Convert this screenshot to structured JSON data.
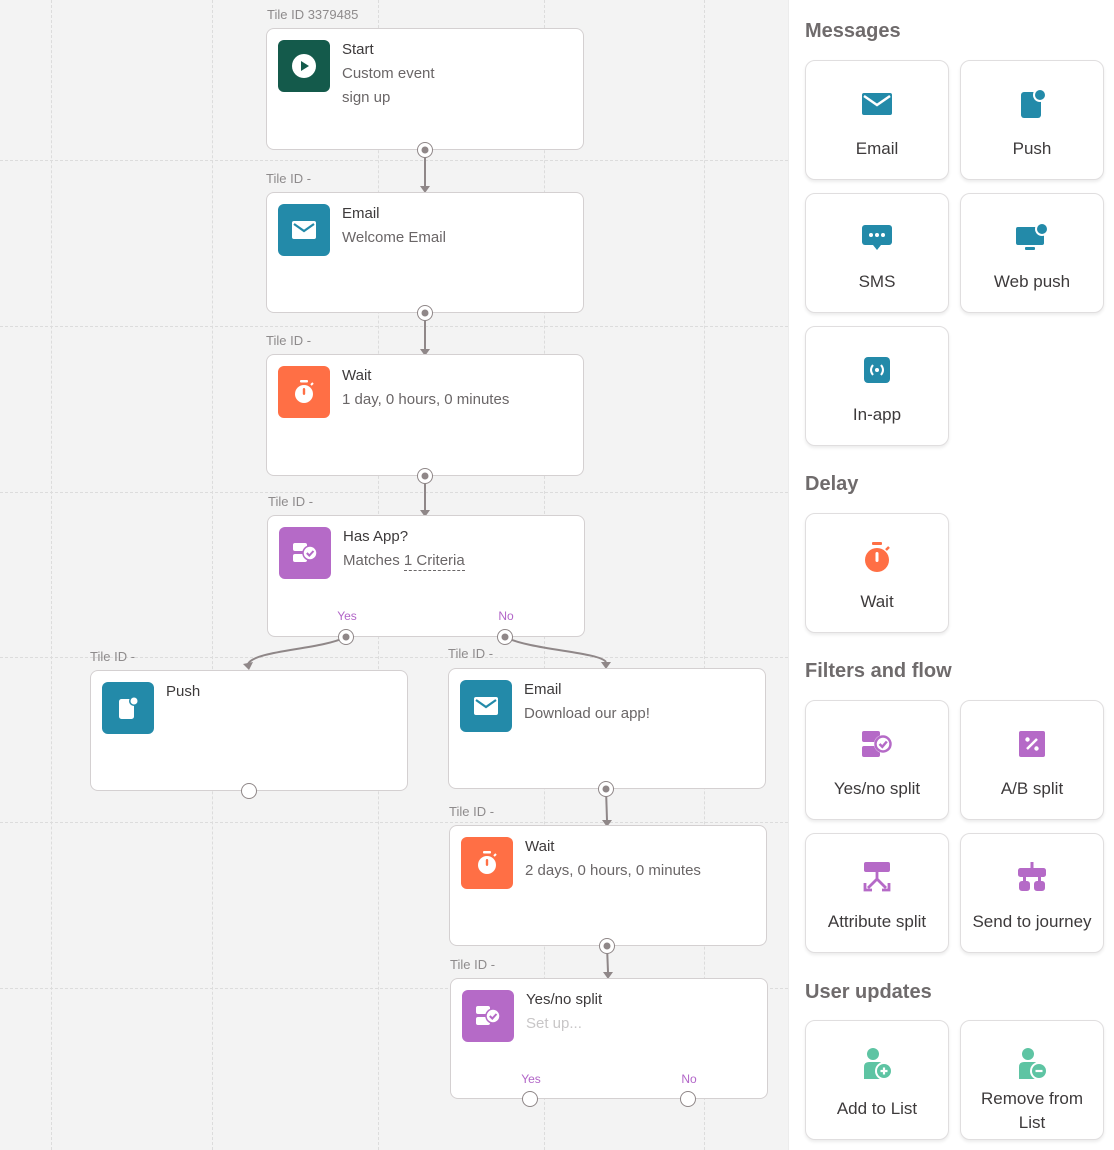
{
  "colors": {
    "teal": "#238aa9",
    "start_green": "#145a4b",
    "orange": "#ff6f45",
    "purple": "#b56ac7",
    "mint": "#5ec4a3",
    "connector": "#8f8788"
  },
  "canvas": {
    "tiles": [
      {
        "id": "start",
        "tile_id_label": "Tile ID 3379485",
        "icon": "play-icon",
        "title": "Start",
        "lines": [
          "Custom event",
          "sign up"
        ]
      },
      {
        "id": "email-welcome",
        "tile_id_label": "Tile ID -",
        "icon": "envelope-icon",
        "title": "Email",
        "lines": [
          "Welcome Email"
        ]
      },
      {
        "id": "wait-1",
        "tile_id_label": "Tile ID -",
        "icon": "stopwatch-icon",
        "title": "Wait",
        "lines": [
          "1 day, 0 hours, 0 minutes"
        ]
      },
      {
        "id": "has-app",
        "tile_id_label": "Tile ID -",
        "icon": "split-check-icon",
        "title": "Has App?",
        "lines_prefix": "Matches ",
        "lines_link": "1 Criteria",
        "yes": "Yes",
        "no": "No"
      },
      {
        "id": "push",
        "tile_id_label": "Tile ID -",
        "icon": "push-notification-icon",
        "title": "Push",
        "lines": []
      },
      {
        "id": "email-download",
        "tile_id_label": "Tile ID -",
        "icon": "envelope-icon",
        "title": "Email",
        "lines": [
          "Download our app!"
        ]
      },
      {
        "id": "wait-2",
        "tile_id_label": "Tile ID -",
        "icon": "stopwatch-icon",
        "title": "Wait",
        "lines": [
          "2 days, 0 hours, 0 minutes"
        ]
      },
      {
        "id": "yes-no-split",
        "tile_id_label": "Tile ID -",
        "icon": "split-check-icon",
        "title": "Yes/no split",
        "placeholder": "Set up...",
        "yes": "Yes",
        "no": "No"
      }
    ]
  },
  "panel": {
    "sections": [
      {
        "title": "Messages",
        "items": [
          {
            "label": "Email",
            "icon": "envelope-icon"
          },
          {
            "label": "Push",
            "icon": "push-notification-icon"
          },
          {
            "label": "SMS",
            "icon": "chat-bubble-icon"
          },
          {
            "label": "Web push",
            "icon": "monitor-notification-icon"
          },
          {
            "label": "In-app",
            "icon": "in-app-icon"
          }
        ]
      },
      {
        "title": "Delay",
        "items": [
          {
            "label": "Wait",
            "icon": "stopwatch-icon"
          }
        ]
      },
      {
        "title": "Filters and flow",
        "items": [
          {
            "label": "Yes/no split",
            "icon": "split-check-icon"
          },
          {
            "label": "A/B split",
            "icon": "percent-icon"
          },
          {
            "label": "Attribute split",
            "icon": "attribute-split-icon"
          },
          {
            "label": "Send to journey",
            "icon": "send-to-journey-icon"
          }
        ]
      },
      {
        "title": "User updates",
        "items": [
          {
            "label": "Add to List",
            "icon": "user-add-icon"
          },
          {
            "label": "Remove from List",
            "icon": "user-remove-icon"
          }
        ]
      }
    ]
  }
}
